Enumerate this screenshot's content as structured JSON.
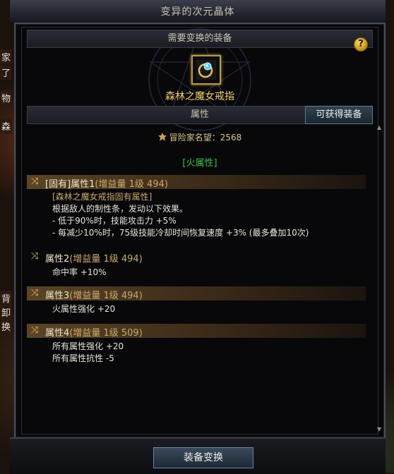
{
  "window": {
    "title": "变异的次元晶体"
  },
  "equipment": {
    "header": "需要变换的装备",
    "item_name": "森林之魔女戒指",
    "help_label": "?"
  },
  "attributes": {
    "header": "属性",
    "obtain_button": "可获得装备",
    "fame_label": "冒险家名望：2568",
    "element": "[火属性]",
    "groups": [
      {
        "title": "[固有]属性1",
        "sub": "(增益量 1级 494)",
        "lines": [
          {
            "text": "[森林之魔女戒指固有属性]",
            "gold": true
          },
          {
            "text": "根据敌人的制性条，发动以下效果。",
            "gold": false
          },
          {
            "text": "- 低于90%时，技能攻击力 +5%",
            "gold": false
          },
          {
            "text": "- 每减少10%时，75级技能冷却时间恢复速度 +3% (最多叠加10次)",
            "gold": false
          }
        ]
      },
      {
        "title": "属性2",
        "sub": "(增益量 1级 494)",
        "lines": [
          {
            "text": "命中率 +10%",
            "gold": false
          }
        ]
      },
      {
        "title": "属性3",
        "sub": "(增益量 1级 494)",
        "lines": [
          {
            "text": "火属性强化 +20",
            "gold": false
          }
        ]
      },
      {
        "title": "属性4",
        "sub": "(增益量 1级 509)",
        "lines": [
          {
            "text": "所有属性强化 +20",
            "gold": false
          },
          {
            "text": "所有属性抗性 -5",
            "gold": false
          }
        ]
      }
    ]
  },
  "footer": {
    "swap_button": "装备变换"
  },
  "side_fragments": [
    "家",
    "了",
    "物",
    "森",
    "背",
    "卸",
    "换"
  ],
  "colors": {
    "item_name": "#f0cf6a",
    "element": "#3dc24a",
    "row_gold": "#c9a96e"
  }
}
